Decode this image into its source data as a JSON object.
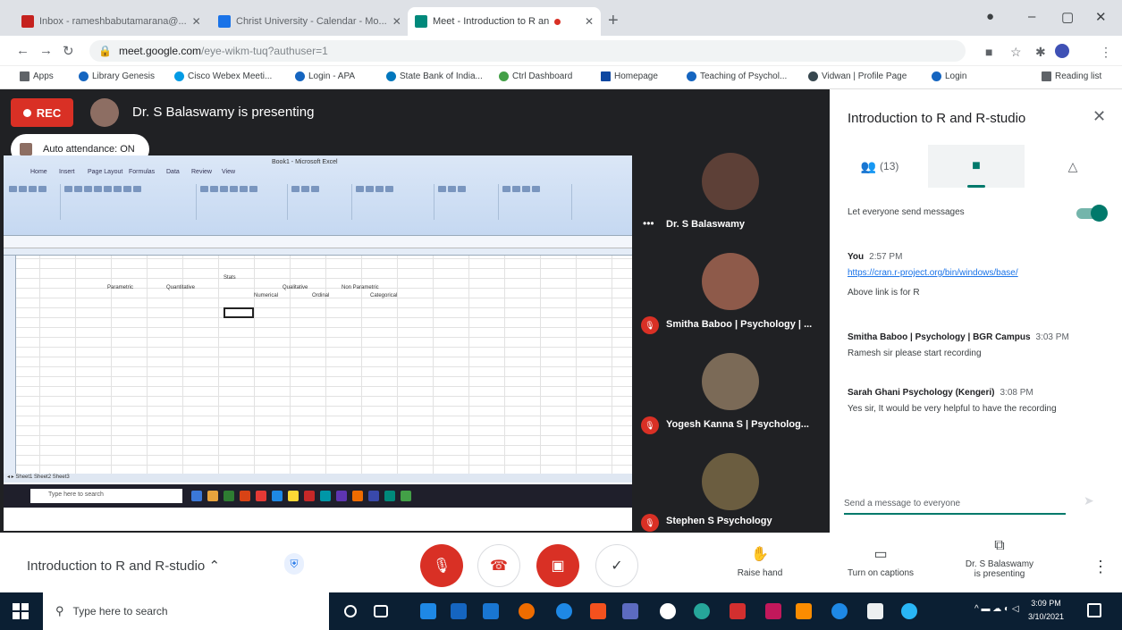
{
  "browser": {
    "tabs": [
      {
        "title": "Inbox - rameshbabutamarana@...",
        "favicon_color": "#c5221f"
      },
      {
        "title": "Christ University - Calendar - Mo...",
        "favicon_color": "#1a73e8"
      },
      {
        "title": "Meet - Introduction to R an",
        "favicon_color": "#00897b"
      }
    ],
    "url_host": "meet.google.com",
    "url_path": "/eye-wikm-tuq?authuser=1",
    "bookmarks": [
      {
        "label": "Apps",
        "color": "#5f6368"
      },
      {
        "label": "Library Genesis",
        "color": "#1565c0"
      },
      {
        "label": "Cisco Webex Meeti...",
        "color": "#039be5"
      },
      {
        "label": "Login - APA",
        "color": "#1565c0"
      },
      {
        "label": "State Bank of India...",
        "color": "#0277bd"
      },
      {
        "label": "Ctrl Dashboard",
        "color": "#43a047"
      },
      {
        "label": "Homepage",
        "color": "#0d47a1"
      },
      {
        "label": "Teaching of Psychol...",
        "color": "#1565c0"
      },
      {
        "label": "Vidwan | Profile Page",
        "color": "#37474f"
      },
      {
        "label": "Login",
        "color": "#1565c0"
      },
      {
        "label": "Reading list",
        "color": "#5f6368"
      }
    ]
  },
  "meet": {
    "rec_label": "REC",
    "presenting_text": "Dr. S Balaswamy is presenting",
    "auto_attendance": "Auto attendance: ON",
    "excel_title": "Book1 - Microsoft Excel",
    "sheet_cells": [
      "Parametric",
      "Quantitative",
      "Stats",
      "Qualitative",
      "Non Parametric",
      "Numerical",
      "Ordinal",
      "Categorical"
    ],
    "participants": [
      {
        "name": "Dr. S Balaswamy",
        "muted": false
      },
      {
        "name": "Smitha Baboo | Psychology | ...",
        "muted": true
      },
      {
        "name": "Yogesh Kanna S | Psycholog...",
        "muted": true
      },
      {
        "name": "Stephen S Psychology",
        "muted": true
      }
    ]
  },
  "panel": {
    "title": "Introduction to R and R-studio",
    "people_count": "(13)",
    "let_everyone": "Let everyone send messages",
    "messages": [
      {
        "sender": "You",
        "time": "2:57 PM",
        "lines": [
          "https://cran.r-project.org/bin/windows/base/",
          "Above link is for R"
        ]
      },
      {
        "sender": "Smitha Baboo | Psychology | BGR Campus",
        "time": "3:03 PM",
        "lines": [
          "Ramesh sir please start recording"
        ]
      },
      {
        "sender": "Sarah Ghani Psychology (Kengeri)",
        "time": "3:08 PM",
        "lines": [
          "Yes sir, It would be very helpful to have the recording"
        ]
      }
    ],
    "input_placeholder": "Send a message to everyone"
  },
  "controls": {
    "meeting_name": "Introduction to R and R-studio",
    "raise_hand": "Raise hand",
    "captions": "Turn on captions",
    "presenting_line1": "Dr. S Balaswamy",
    "presenting_line2": "is presenting"
  },
  "taskbar": {
    "search_placeholder": "Type here to search",
    "time": "3:09 PM",
    "date": "3/10/2021"
  }
}
